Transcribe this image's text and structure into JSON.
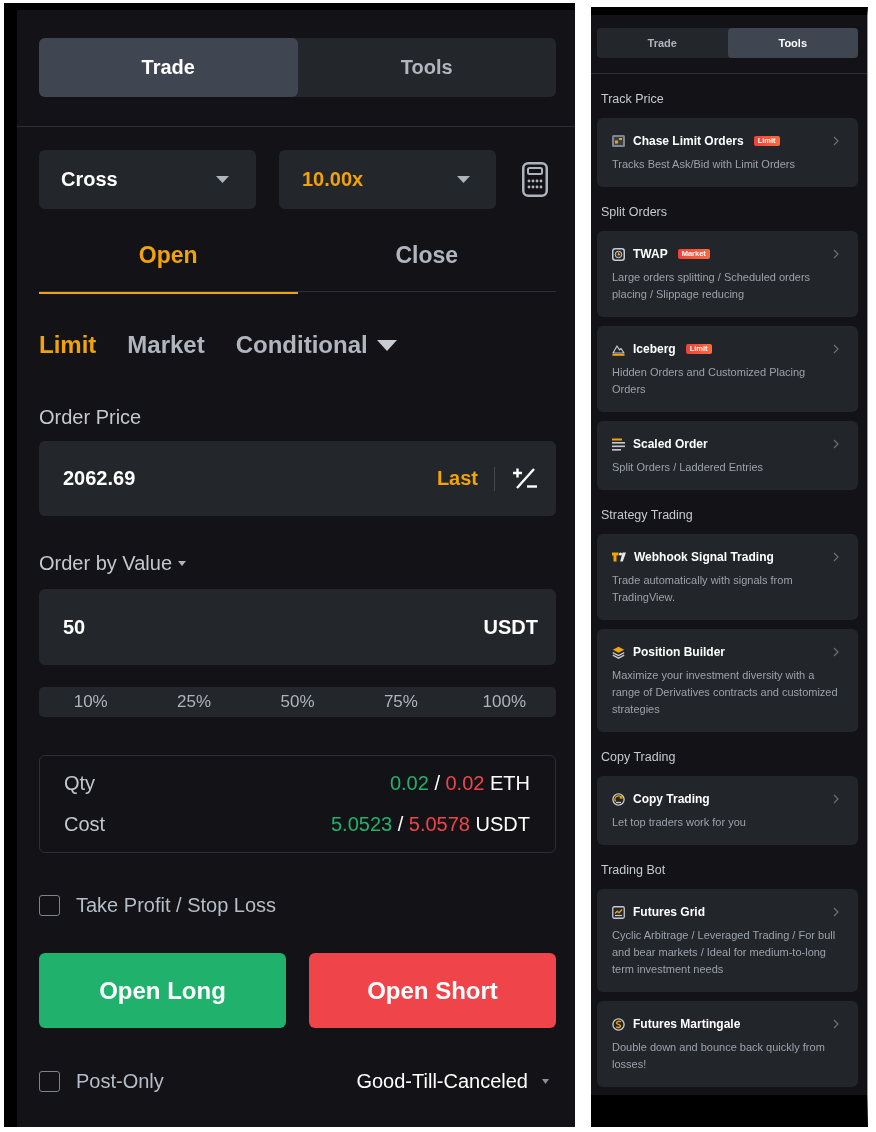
{
  "trade_panel": {
    "tabs": [
      {
        "label": "Trade",
        "selected": true
      },
      {
        "label": "Tools",
        "selected": false
      }
    ],
    "margin_mode": "Cross",
    "leverage": "10.00x",
    "position_tabs": [
      {
        "label": "Open",
        "selected": true
      },
      {
        "label": "Close",
        "selected": false
      }
    ],
    "order_types": [
      {
        "label": "Limit",
        "selected": true,
        "kind": "tab"
      },
      {
        "label": "Market",
        "selected": false,
        "kind": "tab"
      },
      {
        "label": "Conditional",
        "selected": false,
        "kind": "dropdown"
      }
    ],
    "order_price": {
      "label": "Order Price",
      "value": "2062.69",
      "reference": "Last"
    },
    "order_value": {
      "label": "Order by Value",
      "value": "50",
      "unit": "USDT"
    },
    "percent_options": [
      "10%",
      "25%",
      "50%",
      "75%",
      "100%"
    ],
    "summary": [
      {
        "label": "Qty",
        "long": "0.02",
        "separator": "/",
        "short": "0.02",
        "unit": "ETH"
      },
      {
        "label": "Cost",
        "long": "5.0523",
        "separator": "/",
        "short": "5.0578",
        "unit": "USDT"
      }
    ],
    "take_profit_stop_loss": {
      "label": "Take Profit / Stop Loss",
      "checked": false
    },
    "actions": [
      {
        "label": "Open Long",
        "kind": "long"
      },
      {
        "label": "Open Short",
        "kind": "short"
      }
    ],
    "post_only": {
      "label": "Post-Only",
      "checked": false
    },
    "time_in_force": "Good-Till-Canceled"
  },
  "tools_panel": {
    "tabs": [
      {
        "label": "Trade",
        "selected": false
      },
      {
        "label": "Tools",
        "selected": true
      }
    ],
    "sections": [
      {
        "title": "Track Price",
        "tools": [
          {
            "name": "Chase Limit Orders",
            "badge": "Limit",
            "description": "Tracks Best Ask/Bid with Limit Orders"
          }
        ]
      },
      {
        "title": "Split Orders",
        "tools": [
          {
            "name": "TWAP",
            "badge": "Market",
            "description": "Large orders splitting / Scheduled orders placing / Slippage reducing"
          },
          {
            "name": "Iceberg",
            "badge": "Limit",
            "description": "Hidden Orders and Customized Placing Orders"
          },
          {
            "name": "Scaled Order",
            "description": "Split Orders / Laddered Entries"
          }
        ]
      },
      {
        "title": "Strategy Trading",
        "tools": [
          {
            "name": "Webhook Signal Trading",
            "description": "Trade automatically with signals from TradingView."
          },
          {
            "name": "Position Builder",
            "description": "Maximize your investment diversity with a range of Derivatives contracts and customized strategies"
          }
        ]
      },
      {
        "title": "Copy Trading",
        "tools": [
          {
            "name": "Copy Trading",
            "description": "Let top traders work for you"
          }
        ]
      },
      {
        "title": "Trading Bot",
        "tools": [
          {
            "name": "Futures Grid",
            "description": "Cyclic Arbitrage / Leveraged Trading / For bull and bear markets / Ideal for medium-to-long term investment needs"
          },
          {
            "name": "Futures Martingale",
            "description": "Double down and bounce back quickly from losses!"
          }
        ]
      }
    ]
  }
}
